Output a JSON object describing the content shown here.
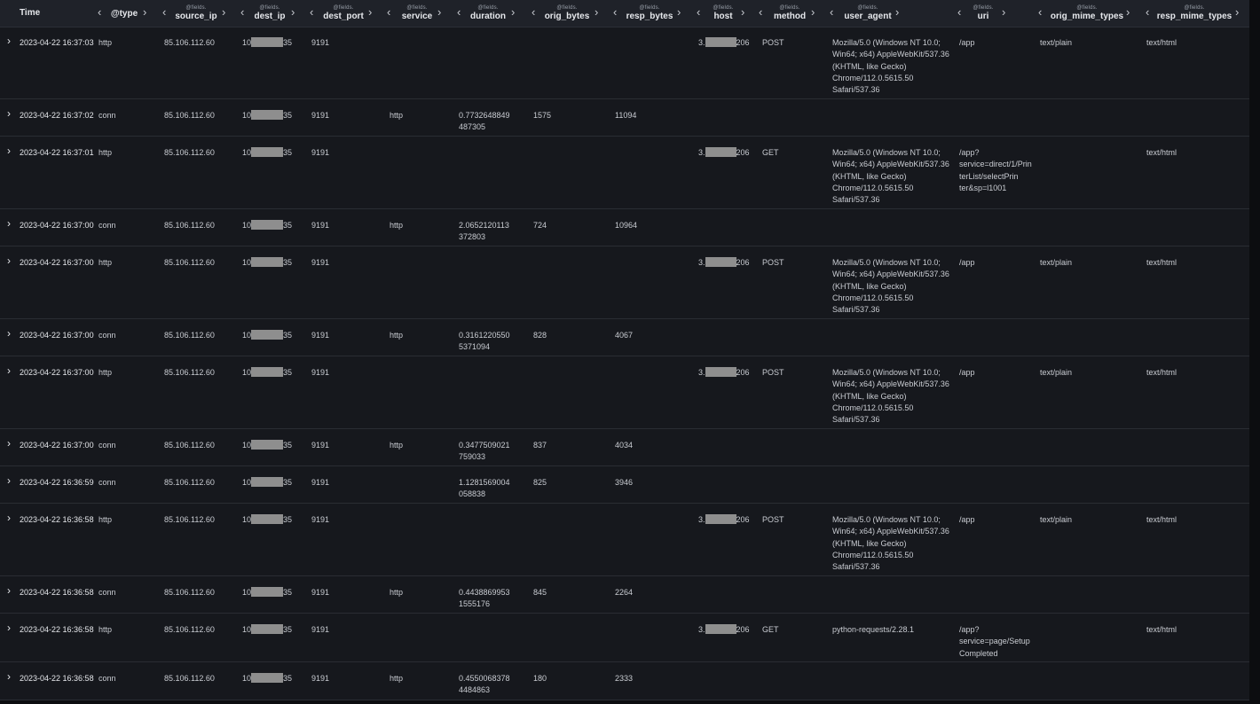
{
  "columns": [
    {
      "key": "time",
      "prefix": "",
      "name": "Time"
    },
    {
      "key": "type",
      "prefix": "",
      "name": "@type"
    },
    {
      "key": "source_ip",
      "prefix": "@fields.",
      "name": "source_ip"
    },
    {
      "key": "dest_ip",
      "prefix": "@fields.",
      "name": "dest_ip"
    },
    {
      "key": "dest_port",
      "prefix": "@fields.",
      "name": "dest_port"
    },
    {
      "key": "service",
      "prefix": "@fields.",
      "name": "service"
    },
    {
      "key": "duration",
      "prefix": "@fields.",
      "name": "duration"
    },
    {
      "key": "orig_bytes",
      "prefix": "@fields.",
      "name": "orig_bytes"
    },
    {
      "key": "resp_bytes",
      "prefix": "@fields.",
      "name": "resp_bytes"
    },
    {
      "key": "host",
      "prefix": "@fields.",
      "name": "host"
    },
    {
      "key": "method",
      "prefix": "@fields.",
      "name": "method"
    },
    {
      "key": "user_agent",
      "prefix": "@fields.",
      "name": "user_agent"
    },
    {
      "key": "uri",
      "prefix": "@fields.",
      "name": "uri"
    },
    {
      "key": "orig_mime_types",
      "prefix": "@fields.",
      "name": "orig_mime_types"
    },
    {
      "key": "resp_mime_types",
      "prefix": "@fields.",
      "name": "resp_mime_types"
    }
  ],
  "icons": {
    "expand": "chevron-right-icon",
    "move_left": "chevron-left-icon",
    "move_right": "chevron-right-icon"
  },
  "colors": {
    "background": "#16181d",
    "header": "#1f2229",
    "mask": "#8e8e8e",
    "text": "#c9ccd2"
  },
  "rows": [
    {
      "time": "2023-04-22 16:37:03",
      "type": "http",
      "source_ip": "85.106.112.60",
      "dest_ip_pre": "10",
      "dest_ip_post": "35",
      "dest_port": "9191",
      "service": "",
      "duration": "",
      "orig_bytes": "",
      "resp_bytes": "",
      "host_pre": "3.",
      "host_post": "206",
      "method": "POST",
      "user_agent": "Mozilla/5.0 (Windows NT 10.0;\nWin64; x64) AppleWebKit/537.36\n(KHTML, like Gecko)\nChrome/112.0.5615.50\nSafari/537.36",
      "uri": "/app",
      "orig_mime_types": "text/plain",
      "resp_mime_types": "text/html"
    },
    {
      "time": "2023-04-22 16:37:02",
      "type": "conn",
      "source_ip": "85.106.112.60",
      "dest_ip_pre": "10",
      "dest_ip_post": "35",
      "dest_port": "9191",
      "service": "http",
      "duration": "0.7732648849\n487305",
      "orig_bytes": "1575",
      "resp_bytes": "11094",
      "host_pre": "",
      "host_post": "",
      "method": "",
      "user_agent": "",
      "uri": "",
      "orig_mime_types": "",
      "resp_mime_types": ""
    },
    {
      "time": "2023-04-22 16:37:01",
      "type": "http",
      "source_ip": "85.106.112.60",
      "dest_ip_pre": "10",
      "dest_ip_post": "35",
      "dest_port": "9191",
      "service": "",
      "duration": "",
      "orig_bytes": "",
      "resp_bytes": "",
      "host_pre": "3.",
      "host_post": "206",
      "method": "GET",
      "user_agent": "Mozilla/5.0 (Windows NT 10.0;\nWin64; x64) AppleWebKit/537.36\n(KHTML, like Gecko)\nChrome/112.0.5615.50\nSafari/537.36",
      "uri": "/app?\nservice=direct/1/Prin\nterList/selectPrin\nter&sp=l1001",
      "orig_mime_types": "",
      "resp_mime_types": "text/html"
    },
    {
      "time": "2023-04-22 16:37:00",
      "type": "conn",
      "source_ip": "85.106.112.60",
      "dest_ip_pre": "10",
      "dest_ip_post": "35",
      "dest_port": "9191",
      "service": "http",
      "duration": "2.0652120113\n372803",
      "orig_bytes": "724",
      "resp_bytes": "10964",
      "host_pre": "",
      "host_post": "",
      "method": "",
      "user_agent": "",
      "uri": "",
      "orig_mime_types": "",
      "resp_mime_types": ""
    },
    {
      "time": "2023-04-22 16:37:00",
      "type": "http",
      "source_ip": "85.106.112.60",
      "dest_ip_pre": "10",
      "dest_ip_post": "35",
      "dest_port": "9191",
      "service": "",
      "duration": "",
      "orig_bytes": "",
      "resp_bytes": "",
      "host_pre": "3.",
      "host_post": "206",
      "method": "POST",
      "user_agent": "Mozilla/5.0 (Windows NT 10.0;\nWin64; x64) AppleWebKit/537.36\n(KHTML, like Gecko)\nChrome/112.0.5615.50\nSafari/537.36",
      "uri": "/app",
      "orig_mime_types": "text/plain",
      "resp_mime_types": "text/html"
    },
    {
      "time": "2023-04-22 16:37:00",
      "type": "conn",
      "source_ip": "85.106.112.60",
      "dest_ip_pre": "10",
      "dest_ip_post": "35",
      "dest_port": "9191",
      "service": "http",
      "duration": "0.3161220550\n5371094",
      "orig_bytes": "828",
      "resp_bytes": "4067",
      "host_pre": "",
      "host_post": "",
      "method": "",
      "user_agent": "",
      "uri": "",
      "orig_mime_types": "",
      "resp_mime_types": ""
    },
    {
      "time": "2023-04-22 16:37:00",
      "type": "http",
      "source_ip": "85.106.112.60",
      "dest_ip_pre": "10",
      "dest_ip_post": "35",
      "dest_port": "9191",
      "service": "",
      "duration": "",
      "orig_bytes": "",
      "resp_bytes": "",
      "host_pre": "3.",
      "host_post": "206",
      "method": "POST",
      "user_agent": "Mozilla/5.0 (Windows NT 10.0;\nWin64; x64) AppleWebKit/537.36\n(KHTML, like Gecko)\nChrome/112.0.5615.50\nSafari/537.36",
      "uri": "/app",
      "orig_mime_types": "text/plain",
      "resp_mime_types": "text/html"
    },
    {
      "time": "2023-04-22 16:37:00",
      "type": "conn",
      "source_ip": "85.106.112.60",
      "dest_ip_pre": "10",
      "dest_ip_post": "35",
      "dest_port": "9191",
      "service": "http",
      "duration": "0.3477509021\n759033",
      "orig_bytes": "837",
      "resp_bytes": "4034",
      "host_pre": "",
      "host_post": "",
      "method": "",
      "user_agent": "",
      "uri": "",
      "orig_mime_types": "",
      "resp_mime_types": ""
    },
    {
      "time": "2023-04-22 16:36:59",
      "type": "conn",
      "source_ip": "85.106.112.60",
      "dest_ip_pre": "10",
      "dest_ip_post": "35",
      "dest_port": "9191",
      "service": "",
      "duration": "1.1281569004\n058838",
      "orig_bytes": "825",
      "resp_bytes": "3946",
      "host_pre": "",
      "host_post": "",
      "method": "",
      "user_agent": "",
      "uri": "",
      "orig_mime_types": "",
      "resp_mime_types": ""
    },
    {
      "time": "2023-04-22 16:36:58",
      "type": "http",
      "source_ip": "85.106.112.60",
      "dest_ip_pre": "10",
      "dest_ip_post": "35",
      "dest_port": "9191",
      "service": "",
      "duration": "",
      "orig_bytes": "",
      "resp_bytes": "",
      "host_pre": "3.",
      "host_post": "206",
      "method": "POST",
      "user_agent": "Mozilla/5.0 (Windows NT 10.0;\nWin64; x64) AppleWebKit/537.36\n(KHTML, like Gecko)\nChrome/112.0.5615.50\nSafari/537.36",
      "uri": "/app",
      "orig_mime_types": "text/plain",
      "resp_mime_types": "text/html"
    },
    {
      "time": "2023-04-22 16:36:58",
      "type": "conn",
      "source_ip": "85.106.112.60",
      "dest_ip_pre": "10",
      "dest_ip_post": "35",
      "dest_port": "9191",
      "service": "http",
      "duration": "0.4438869953\n1555176",
      "orig_bytes": "845",
      "resp_bytes": "2264",
      "host_pre": "",
      "host_post": "",
      "method": "",
      "user_agent": "",
      "uri": "",
      "orig_mime_types": "",
      "resp_mime_types": ""
    },
    {
      "time": "2023-04-22 16:36:58",
      "type": "http",
      "source_ip": "85.106.112.60",
      "dest_ip_pre": "10",
      "dest_ip_post": "35",
      "dest_port": "9191",
      "service": "",
      "duration": "",
      "orig_bytes": "",
      "resp_bytes": "",
      "host_pre": "3.",
      "host_post": "206",
      "method": "GET",
      "user_agent": "python-requests/2.28.1",
      "uri": "/app?\nservice=page/Setup\nCompleted",
      "orig_mime_types": "",
      "resp_mime_types": "text/html"
    },
    {
      "time": "2023-04-22 16:36:58",
      "type": "conn",
      "source_ip": "85.106.112.60",
      "dest_ip_pre": "10",
      "dest_ip_post": "35",
      "dest_port": "9191",
      "service": "http",
      "duration": "0.4550068378\n4484863",
      "orig_bytes": "180",
      "resp_bytes": "2333",
      "host_pre": "",
      "host_post": "",
      "method": "",
      "user_agent": "",
      "uri": "",
      "orig_mime_types": "",
      "resp_mime_types": ""
    }
  ]
}
